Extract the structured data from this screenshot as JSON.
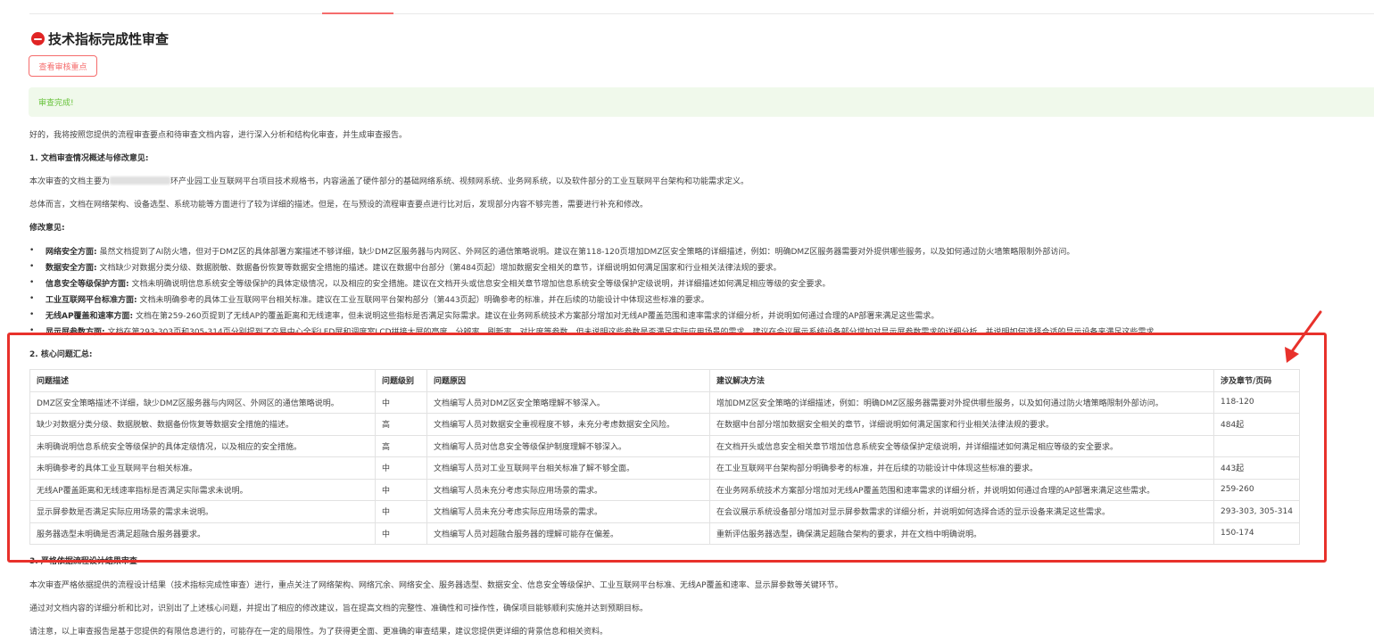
{
  "page": {
    "title": "技术指标完成性审查",
    "review_button": "查看审核重点",
    "status_message": "审查完成!",
    "intro": "好的，我将按照您提供的流程审查要点和待审查文档内容，进行深入分析和结构化审查，并生成审查报告。"
  },
  "section1": {
    "heading": "1. 文档审查情况概述与修改意见:",
    "para1_prefix": "本次审查的文档主要为",
    "para1_suffix": "环产业园工业互联网平台项目技术规格书，内容涵盖了硬件部分的基础网络系统、视频网系统、业务网系统，以及软件部分的工业互联网平台架构和功能需求定义。",
    "para2": "总体而言，文档在网络架构、设备选型、系统功能等方面进行了较为详细的描述。但是，在与预设的流程审查要点进行比对后，发现部分内容不够完善，需要进行补充和修改。",
    "suggest_heading": "修改意见:",
    "bullets": [
      {
        "label": "网络安全方面:",
        "text": "虽然文档提到了AI防火墙，但对于DMZ区的具体部署方案描述不够详细，缺少DMZ区服务器与内网区、外网区的通信策略说明。建议在第118-120页增加DMZ区安全策略的详细描述，例如：明确DMZ区服务器需要对外提供哪些服务，以及如何通过防火墙策略限制外部访问。"
      },
      {
        "label": "数据安全方面:",
        "text": "文档缺少对数据分类分级、数据脱敏、数据备份恢复等数据安全措施的描述。建议在数据中台部分（第484页起）增加数据安全相关的章节，详细说明如何满足国家和行业相关法律法规的要求。"
      },
      {
        "label": "信息安全等级保护方面:",
        "text": "文档未明确说明信息系统安全等级保护的具体定级情况，以及相应的安全措施。建议在文档开头或信息安全相关章节增加信息系统安全等级保护定级说明，并详细描述如何满足相应等级的安全要求。"
      },
      {
        "label": "工业互联网平台标准方面:",
        "text": "文档未明确参考的具体工业互联网平台相关标准。建议在工业互联网平台架构部分（第443页起）明确参考的标准，并在后续的功能设计中体现这些标准的要求。"
      },
      {
        "label": "无线AP覆盖和速率方面:",
        "text": "文档在第259-260页提到了无线AP的覆盖距离和无线速率，但未说明这些指标是否满足实际需求。建议在业务网系统技术方案部分增加对无线AP覆盖范围和速率需求的详细分析，并说明如何通过合理的AP部署来满足这些需求。"
      },
      {
        "label": "显示屏参数方面:",
        "text": "文档在第293-303页和305-314页分别提到了交易中心全彩LED屏和调度室LCD拼接大屏的亮度、分辨率、刷新率、对比度等参数，但未说明这些参数是否满足实际应用场景的需求。建议在会议展示系统设备部分增加对显示屏参数需求的详细分析，并说明如何选择合适的显示设备来满足这些需求。"
      }
    ]
  },
  "section2": {
    "heading": "2. 核心问题汇总:",
    "columns": [
      "问题描述",
      "问题级别",
      "问题原因",
      "建议解决方法",
      "涉及章节/页码"
    ],
    "rows": [
      [
        "DMZ区安全策略描述不详细，缺少DMZ区服务器与内网区、外网区的通信策略说明。",
        "中",
        "文档编写人员对DMZ区安全策略理解不够深入。",
        "增加DMZ区安全策略的详细描述，例如：明确DMZ区服务器需要对外提供哪些服务，以及如何通过防火墙策略限制外部访问。",
        "118-120"
      ],
      [
        "缺少对数据分类分级、数据脱敏、数据备份恢复等数据安全措施的描述。",
        "高",
        "文档编写人员对数据安全重视程度不够，未充分考虑数据安全风险。",
        "在数据中台部分增加数据安全相关的章节，详细说明如何满足国家和行业相关法律法规的要求。",
        "484起"
      ],
      [
        "未明确说明信息系统安全等级保护的具体定级情况，以及相应的安全措施。",
        "高",
        "文档编写人员对信息安全等级保护制度理解不够深入。",
        "在文档开头或信息安全相关章节增加信息系统安全等级保护定级说明，并详细描述如何满足相应等级的安全要求。",
        ""
      ],
      [
        "未明确参考的具体工业互联网平台相关标准。",
        "中",
        "文档编写人员对工业互联网平台相关标准了解不够全面。",
        "在工业互联网平台架构部分明确参考的标准，并在后续的功能设计中体现这些标准的要求。",
        "443起"
      ],
      [
        "无线AP覆盖距离和无线速率指标是否满足实际需求未说明。",
        "中",
        "文档编写人员未充分考虑实际应用场景的需求。",
        "在业务网系统技术方案部分增加对无线AP覆盖范围和速率需求的详细分析，并说明如何通过合理的AP部署来满足这些需求。",
        "259-260"
      ],
      [
        "显示屏参数是否满足实际应用场景的需求未说明。",
        "中",
        "文档编写人员未充分考虑实际应用场景的需求。",
        "在会议展示系统设备部分增加对显示屏参数需求的详细分析，并说明如何选择合适的显示设备来满足这些需求。",
        "293-303, 305-314"
      ],
      [
        "服务器选型未明确是否满足超融合服务器要求。",
        "中",
        "文档编写人员对超融合服务器的理解可能存在偏差。",
        "重新评估服务器选型，确保满足超融合架构的要求，并在文档中明确说明。",
        "150-174"
      ]
    ]
  },
  "section3": {
    "heading": "3. 严格依据流程设计结果审查",
    "para1": "本次审查严格依据提供的流程设计结果（技术指标完成性审查）进行，重点关注了网络架构、网络冗余、网络安全、服务器选型、数据安全、信息安全等级保护、工业互联网平台标准、无线AP覆盖和速率、显示屏参数等关键环节。",
    "para2": "通过对文档内容的详细分析和比对，识别出了上述核心问题，并提出了相应的修改建议，旨在提高文档的完整性、准确性和可操作性，确保项目能够顺利实施并达到预期目标。",
    "para3": "请注意，以上审查报告是基于您提供的有限信息进行的，可能存在一定的局限性。为了获得更全面、更准确的审查结果，建议您提供更详细的背景信息和相关资料。"
  },
  "colors": {
    "accent_red": "#e8312b",
    "button_red": "#f56c6c",
    "success_bg": "#f0f9eb",
    "success_text": "#67c23a"
  }
}
